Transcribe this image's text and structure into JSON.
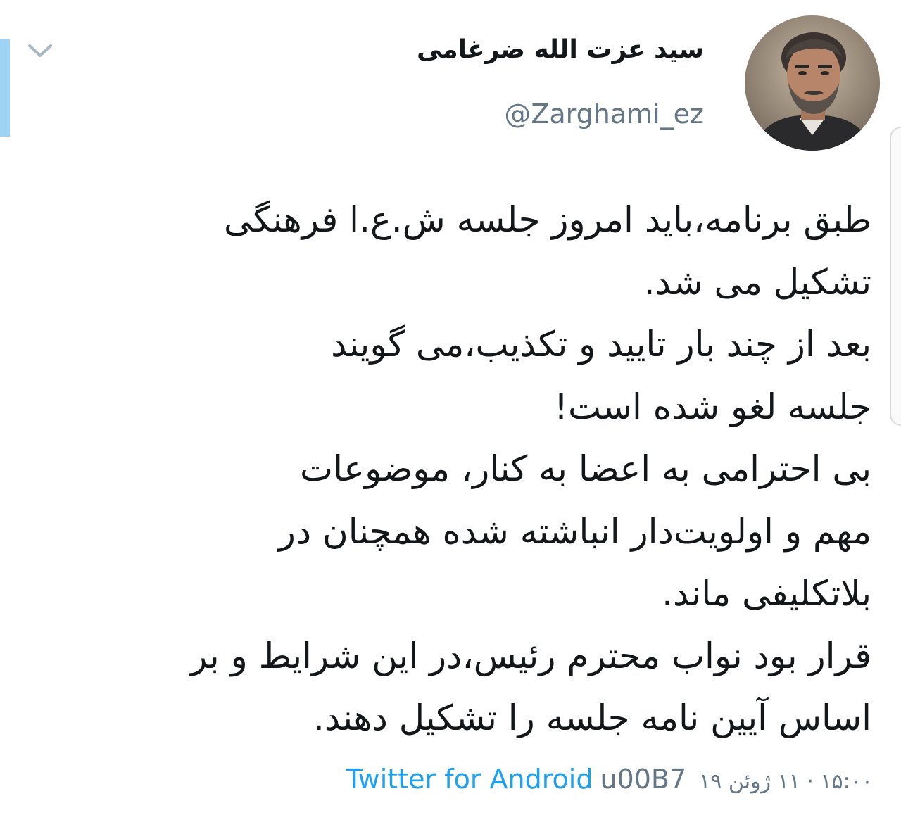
{
  "tweet": {
    "author": {
      "display_name": "سید عزت الله ضرغامی",
      "handle": "@Zarghami_ez"
    },
    "body_lines": [
      "طبق برنامه،باید امروز جلسه ش.ع.ا فرهنگی",
      "تشکیل می شد.",
      "بعد از چند بار تایید و تکذیب،می گویند",
      "جلسه لغو شده است!",
      " بی احترامی به اعضا به کنار، موضوعات",
      "مهم و اولویت‌دار انباشته شده همچنان در",
      "بلاتکلیفی ماند.",
      "قرار بود نواب محترم رئیس،در این شرایط و بر",
      "اساس آیین نامه جلسه را تشکیل دهند."
    ],
    "meta": {
      "source": "Twitter for Android",
      "separator_code": "u00B7",
      "timestamp": "۱۵:۰۰ · ۱۱ ژوئن ۱۹"
    }
  },
  "icons": {
    "menu": "chevron-down-icon",
    "avatar": "profile-photo"
  },
  "colors": {
    "accent": "#1da1f2",
    "accent_bar": "#9fd3f5",
    "text": "#14171a",
    "muted": "#657786"
  }
}
